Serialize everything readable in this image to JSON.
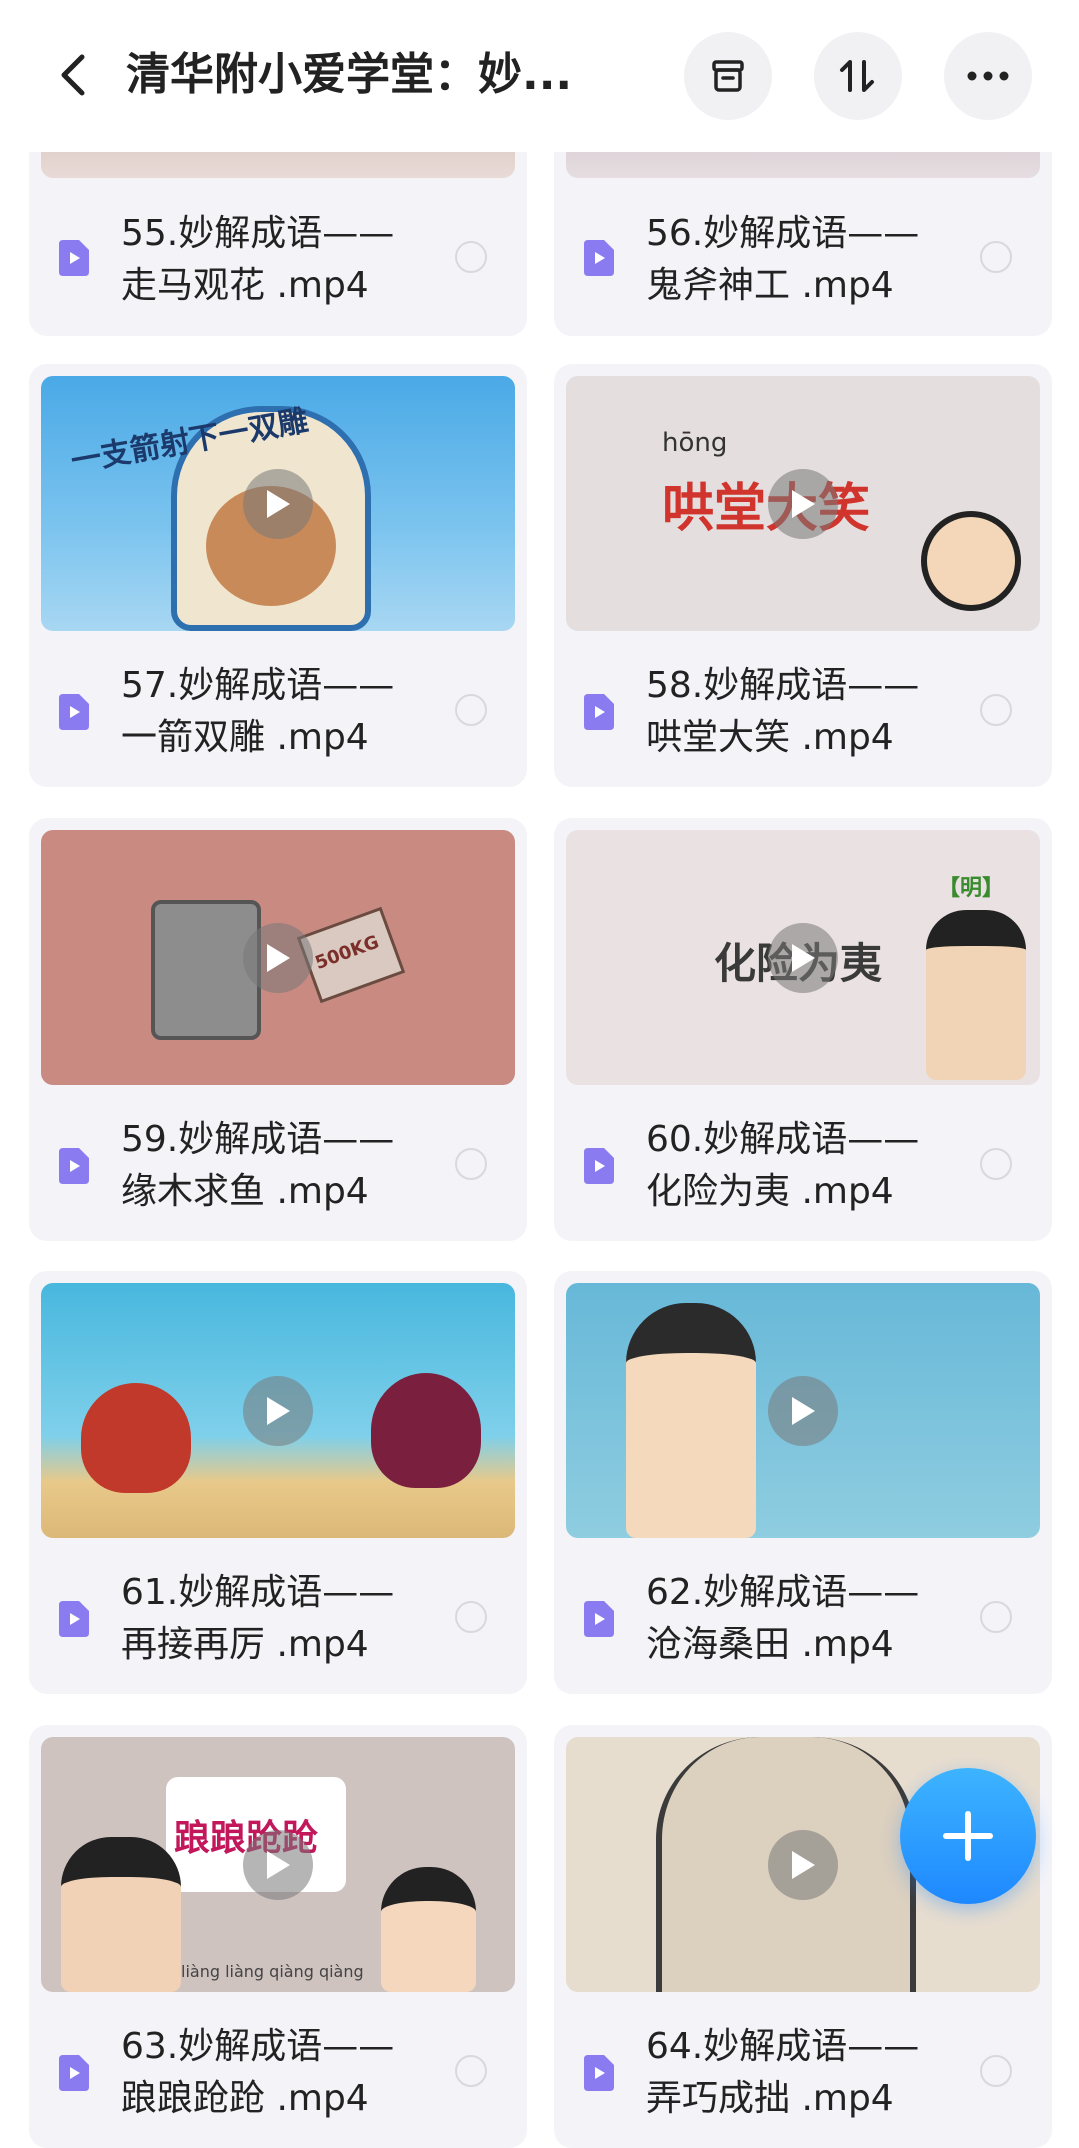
{
  "header": {
    "title": "清华附小爱学堂：妙...",
    "icons": {
      "back": "chevron-left-icon",
      "archive": "archive-box-icon",
      "sort": "sort-icon",
      "more": "more-horizontal-icon"
    }
  },
  "files": [
    {
      "line1": "55.妙解成语——",
      "line2": "走马观花 .mp4",
      "thumb_caption": ""
    },
    {
      "line1": "56.妙解成语——",
      "line2": "鬼斧神工 .mp4",
      "thumb_caption": ""
    },
    {
      "line1": "57.妙解成语——",
      "line2": "一箭双雕 .mp4",
      "thumb_caption": "一支箭射下一双雕"
    },
    {
      "line1": "58.妙解成语——",
      "line2": "哄堂大笑 .mp4",
      "thumb_caption": "哄堂大笑",
      "thumb_pinyin": "hōng"
    },
    {
      "line1": "59.妙解成语——",
      "line2": "缘木求鱼 .mp4",
      "thumb_caption": "500KG"
    },
    {
      "line1": "60.妙解成语——",
      "line2": "化险为夷 .mp4",
      "thumb_caption": "化险为夷",
      "thumb_tag": "【明】"
    },
    {
      "line1": "61.妙解成语——",
      "line2": "再接再厉 .mp4",
      "thumb_caption": ""
    },
    {
      "line1": "62.妙解成语——",
      "line2": "沧海桑田 .mp4",
      "thumb_caption": ""
    },
    {
      "line1": "63.妙解成语——",
      "line2": "踉踉跄跄 .mp4",
      "thumb_caption": "踉踉跄跄",
      "thumb_pinyin": "liàng liàng qiàng qiàng"
    },
    {
      "line1": "64.妙解成语——",
      "line2": "弄巧成拙 .mp4",
      "thumb_caption": ""
    }
  ],
  "colors": {
    "card_bg": "#f3f3f8",
    "file_icon": "#8a7cf0",
    "fab": "#1e88ff"
  }
}
